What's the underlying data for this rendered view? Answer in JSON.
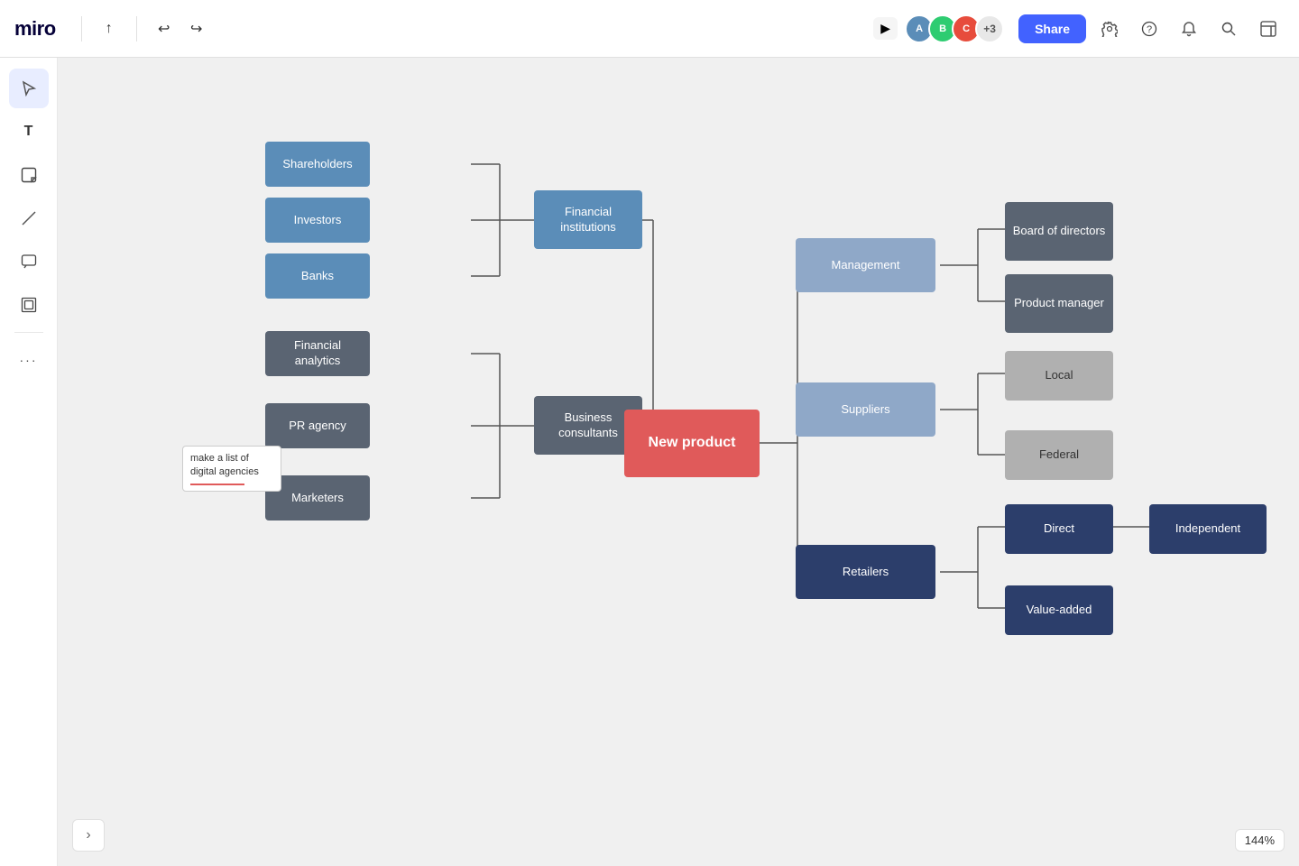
{
  "app": {
    "logo": "miro",
    "zoom": "144%",
    "share_label": "Share",
    "expand_icon": "›"
  },
  "toolbar": {
    "undo_icon": "↩",
    "redo_icon": "↪",
    "upload_icon": "⬆",
    "select_icon": "▶",
    "text_icon": "T",
    "note_icon": "☐",
    "sticky_icon": "🗒",
    "line_icon": "/",
    "comment_icon": "💬",
    "frame_icon": "⊞",
    "more_icon": "..."
  },
  "topbar_icons": {
    "filter_icon": "⚙",
    "help_icon": "?",
    "bell_icon": "🔔",
    "search_icon": "🔍",
    "panel_icon": "▣"
  },
  "avatars": [
    {
      "color": "#4262ff",
      "initials": "A"
    },
    {
      "color": "#2ecc71",
      "initials": "B"
    },
    {
      "color": "#e74c3c",
      "initials": "C"
    }
  ],
  "avatar_count": "+3",
  "nodes": {
    "shareholders": "Shareholders",
    "investors": "Investors",
    "banks": "Banks",
    "financial_institutions": "Financial institutions",
    "financial_analytics": "Financial analytics",
    "pr_agency": "PR agency",
    "business_consultants": "Business consultants",
    "marketers": "Marketers",
    "new_product": "New product",
    "management": "Management",
    "board_of_directors": "Board of directors",
    "product_manager": "Product manager",
    "suppliers": "Suppliers",
    "local": "Local",
    "federal": "Federal",
    "retailers": "Retailers",
    "direct": "Direct",
    "value_added": "Value-added",
    "independent": "Independent"
  },
  "note": {
    "text": "make a list of digital agencies"
  }
}
